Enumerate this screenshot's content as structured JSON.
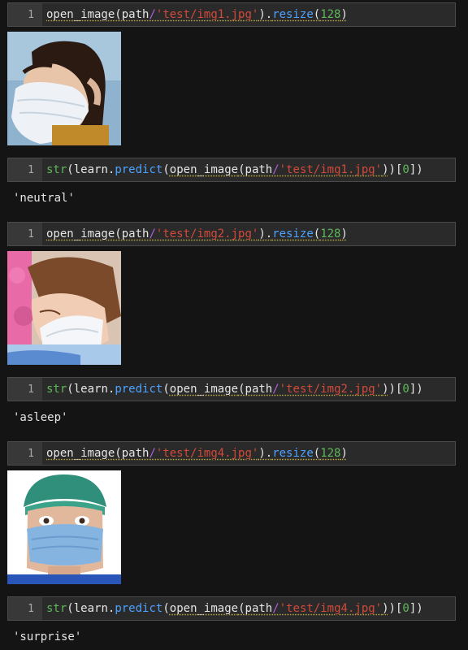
{
  "cells": [
    {
      "line": "1",
      "output_text": null
    },
    {
      "line": "1",
      "output_text": "'neutral'"
    },
    {
      "line": "1",
      "output_text": null
    },
    {
      "line": "1",
      "output_text": "'asleep'"
    },
    {
      "line": "1",
      "output_text": null
    },
    {
      "line": "1",
      "output_text": "'surprise'"
    }
  ],
  "code": {
    "open_image": "open_image",
    "path": "path",
    "slash": "/",
    "img1": "'test/img1.jpg'",
    "img2": "'test/img2.jpg'",
    "img4": "'test/img4.jpg'",
    "resize": "resize",
    "size": "128",
    "str": "str",
    "learn": "learn",
    "predict": "predict",
    "index": "0"
  },
  "images": [
    {
      "name": "masked-woman-side-profile"
    },
    {
      "name": "masked-child-sleeping"
    },
    {
      "name": "masked-woman-surgical-cap"
    }
  ]
}
